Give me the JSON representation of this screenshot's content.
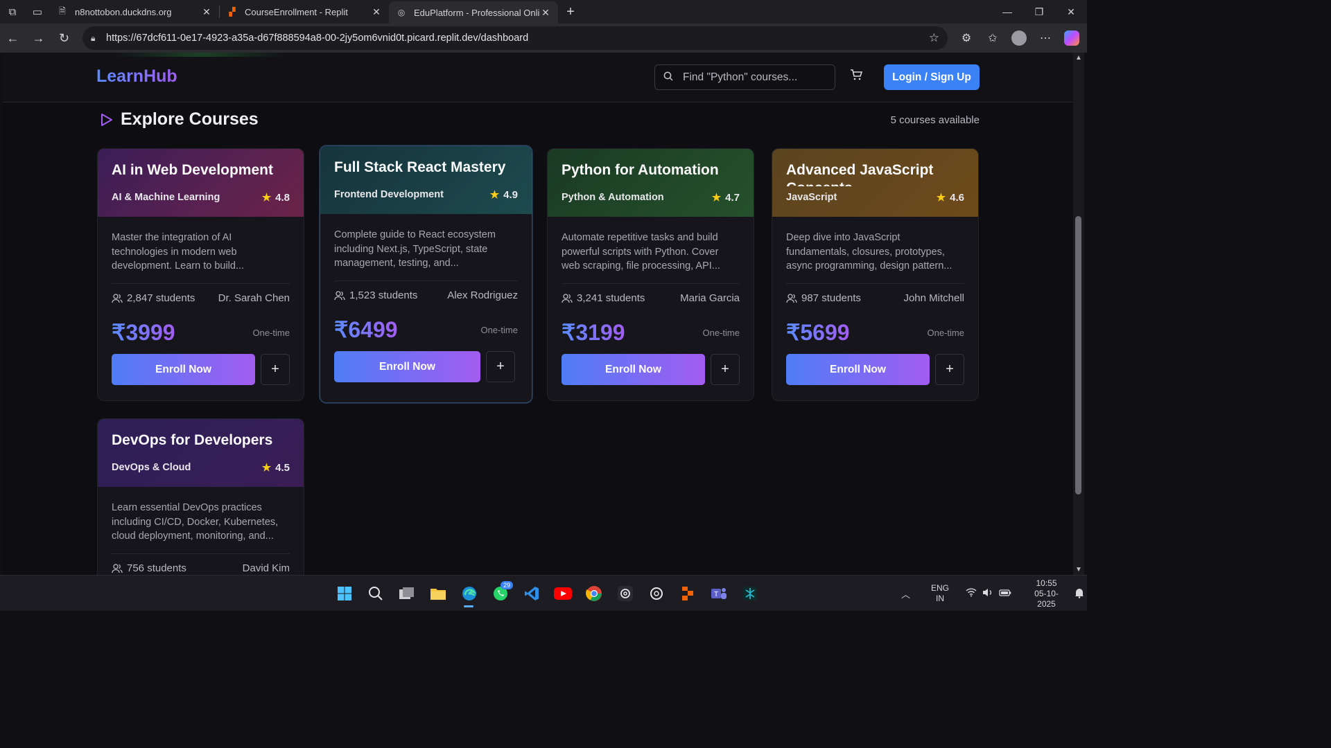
{
  "browser": {
    "tabs": [
      {
        "label": "n8nottobon.duckdns.org",
        "favicon": "page-icon"
      },
      {
        "label": "CourseEnrollment - Replit",
        "favicon": "replit-icon"
      },
      {
        "label": "EduPlatform - Professional Online",
        "favicon": "edge-icon"
      }
    ],
    "url": "https://67dcf611-0e17-4923-a35a-d67f888594a8-00-2jy5om6vnid0t.picard.replit.dev/dashboard"
  },
  "site": {
    "logo": "LearnHub",
    "search_placeholder": "Find \"Python\" courses...",
    "login_label": "Login / Sign Up",
    "section_title": "Explore Courses",
    "count_text": "5 courses available"
  },
  "courses": [
    {
      "title": "AI in Web Development",
      "category": "AI & Machine Learning",
      "rating": "4.8",
      "description": "Master the integration of AI technologies in modern web development. Learn to build...",
      "students": "2,847 students",
      "instructor": "Dr. Sarah Chen",
      "price": "₹3999",
      "price_type": "One-time",
      "enroll_label": "Enroll Now",
      "add_label": "+",
      "theme": "#5a2250"
    },
    {
      "title": "Full Stack React Mastery",
      "category": "Frontend Development",
      "rating": "4.9",
      "description": "Complete guide to React ecosystem including Next.js, TypeScript, state management, testing, and...",
      "students": "1,523 students",
      "instructor": "Alex Rodriguez",
      "price": "₹6499",
      "price_type": "One-time",
      "enroll_label": "Enroll Now",
      "add_label": "+",
      "theme": "#1d4a4e"
    },
    {
      "title": "Python for Automation",
      "category": "Python & Automation",
      "rating": "4.7",
      "description": "Automate repetitive tasks and build powerful scripts with Python. Cover web scraping, file processing, API...",
      "students": "3,241 students",
      "instructor": "Maria Garcia",
      "price": "₹3199",
      "price_type": "One-time",
      "enroll_label": "Enroll Now",
      "add_label": "+",
      "theme": "#25512b"
    },
    {
      "title": "Advanced JavaScript Concepts",
      "category": "JavaScript",
      "rating": "4.6",
      "description": "Deep dive into JavaScript fundamentals, closures, prototypes, async programming, design pattern...",
      "students": "987 students",
      "instructor": "John Mitchell",
      "price": "₹5699",
      "price_type": "One-time",
      "enroll_label": "Enroll Now",
      "add_label": "+",
      "theme": "#6e4a1a"
    },
    {
      "title": "DevOps for Developers",
      "category": "DevOps & Cloud",
      "rating": "4.5",
      "description": "Learn essential DevOps practices including CI/CD, Docker, Kubernetes, cloud deployment, monitoring, and...",
      "students": "756 students",
      "instructor": "David Kim",
      "price": "",
      "price_type": "",
      "enroll_label": "",
      "add_label": "",
      "theme": "#3a1d55"
    }
  ],
  "taskbar": {
    "whatsapp_badge": "29",
    "lang_line1": "ENG",
    "lang_line2": "IN",
    "time": "10:55",
    "date": "05-10-2025"
  },
  "colors": {
    "accent": "#3b82f6",
    "gradient_start": "#5b8cff",
    "gradient_end": "#a25cf0",
    "star": "#facc15"
  }
}
